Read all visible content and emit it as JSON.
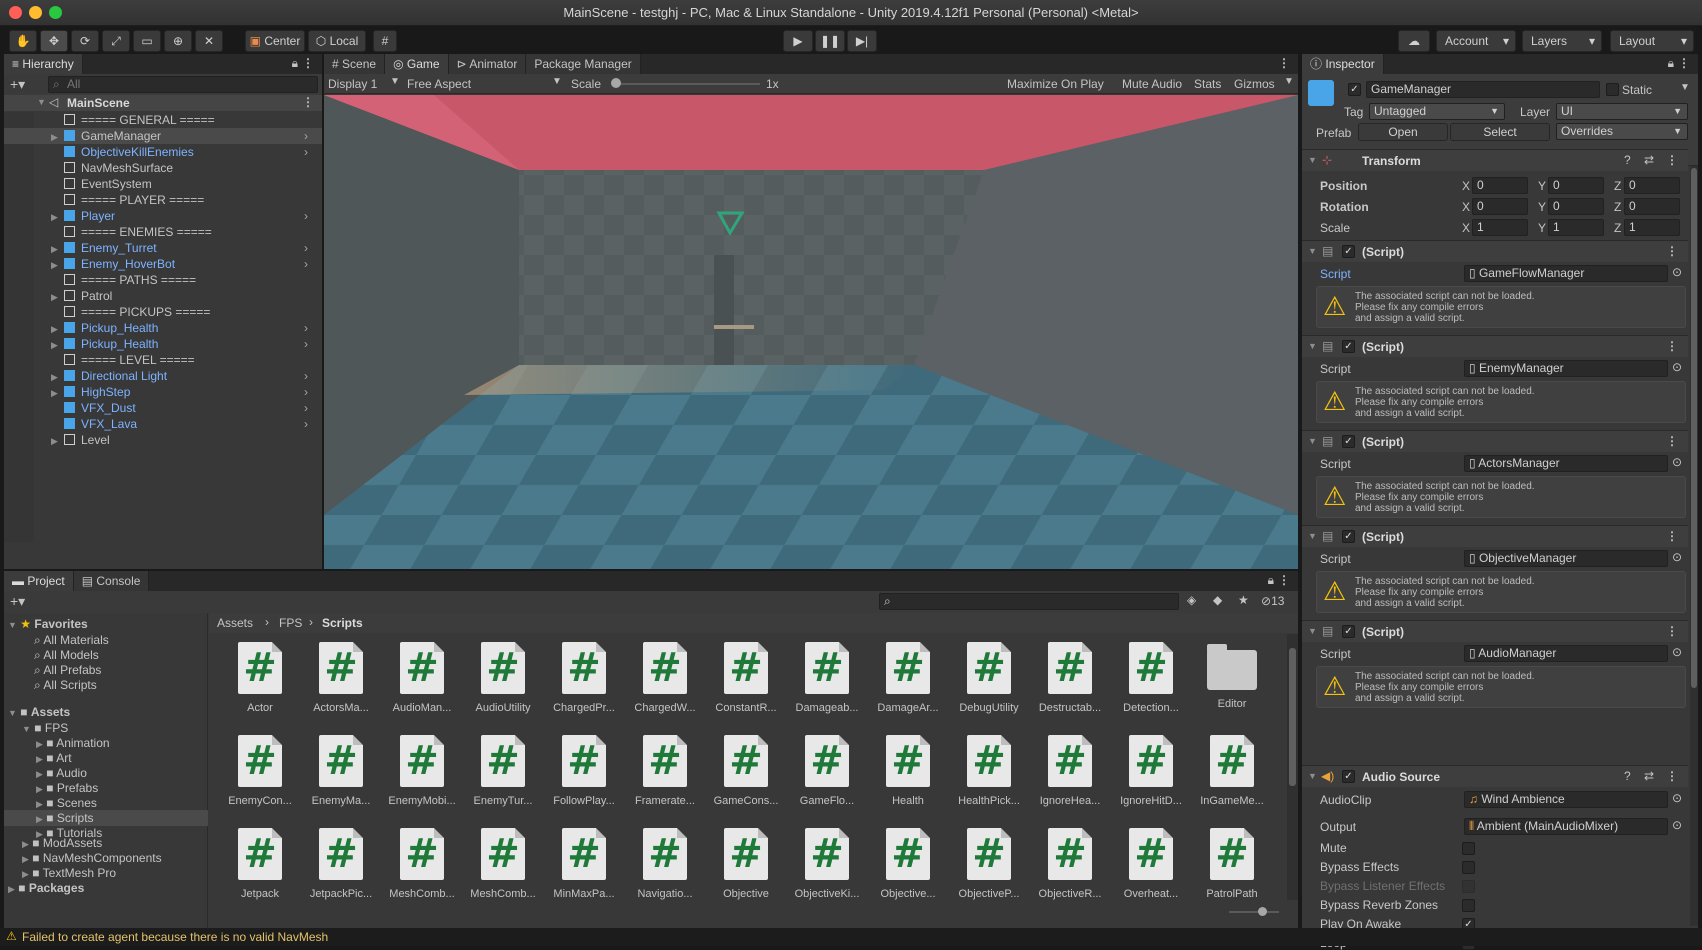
{
  "window": {
    "title": "MainScene - testghj - PC, Mac & Linux Standalone - Unity 2019.4.12f1 Personal (Personal) <Metal>"
  },
  "toolbar": {
    "pivot_label": "Center",
    "space_label": "Local",
    "account_label": "Account",
    "layers_label": "Layers",
    "layout_label": "Layout"
  },
  "hierarchy": {
    "tab_label": "Hierarchy",
    "search_placeholder": "All",
    "scene_name": "MainScene",
    "items": [
      {
        "label": "===== GENERAL =====",
        "prefab": false,
        "expandable": false,
        "chevron": false
      },
      {
        "label": "GameManager",
        "prefab": true,
        "expandable": true,
        "chevron": true,
        "selected": true,
        "plain": true
      },
      {
        "label": "ObjectiveKillEnemies",
        "prefab": true,
        "expandable": false,
        "chevron": true
      },
      {
        "label": "NavMeshSurface",
        "prefab": false,
        "expandable": false,
        "chevron": false
      },
      {
        "label": "EventSystem",
        "prefab": false,
        "expandable": false,
        "chevron": false
      },
      {
        "label": "===== PLAYER =====",
        "prefab": false,
        "expandable": false,
        "chevron": false
      },
      {
        "label": "Player",
        "prefab": true,
        "expandable": true,
        "chevron": true
      },
      {
        "label": "===== ENEMIES =====",
        "prefab": false,
        "expandable": false,
        "chevron": false
      },
      {
        "label": "Enemy_Turret",
        "prefab": true,
        "expandable": true,
        "chevron": true
      },
      {
        "label": "Enemy_HoverBot",
        "prefab": true,
        "expandable": true,
        "chevron": true
      },
      {
        "label": "===== PATHS =====",
        "prefab": false,
        "expandable": false,
        "chevron": false
      },
      {
        "label": "Patrol",
        "prefab": false,
        "expandable": true,
        "chevron": false
      },
      {
        "label": "===== PICKUPS =====",
        "prefab": false,
        "expandable": false,
        "chevron": false
      },
      {
        "label": "Pickup_Health",
        "prefab": true,
        "expandable": true,
        "chevron": true
      },
      {
        "label": "Pickup_Health",
        "prefab": true,
        "expandable": true,
        "chevron": true
      },
      {
        "label": "===== LEVEL =====",
        "prefab": false,
        "expandable": false,
        "chevron": false
      },
      {
        "label": "Directional Light",
        "prefab": true,
        "expandable": true,
        "chevron": true
      },
      {
        "label": "HighStep",
        "prefab": true,
        "expandable": true,
        "chevron": true
      },
      {
        "label": "VFX_Dust",
        "prefab": true,
        "expandable": false,
        "chevron": true
      },
      {
        "label": "VFX_Lava",
        "prefab": true,
        "expandable": false,
        "chevron": true
      },
      {
        "label": "Level",
        "prefab": false,
        "expandable": true,
        "chevron": false
      }
    ]
  },
  "game_view": {
    "tabs": [
      "Scene",
      "Game",
      "Animator",
      "Package Manager"
    ],
    "display": "Display 1",
    "aspect": "Free Aspect",
    "scale_label": "Scale",
    "scale_value": "1x",
    "buttons": [
      "Maximize On Play",
      "Mute Audio",
      "Stats",
      "Gizmos"
    ]
  },
  "project": {
    "tabs": [
      "Project",
      "Console"
    ],
    "hidden_count": "13",
    "favorites_label": "Favorites",
    "favorites": [
      "All Materials",
      "All Models",
      "All Prefabs",
      "All Scripts"
    ],
    "assets_label": "Assets",
    "fps_label": "FPS",
    "fps_children": [
      "Animation",
      "Art",
      "Audio",
      "Prefabs",
      "Scenes",
      "Scripts",
      "Tutorials"
    ],
    "asset_roots": [
      "ModAssets",
      "NavMeshComponents",
      "TextMesh Pro"
    ],
    "packages_label": "Packages",
    "breadcrumb": [
      "Assets",
      "FPS",
      "Scripts"
    ],
    "items": [
      "Actor",
      "ActorsMa...",
      "AudioMan...",
      "AudioUtility",
      "ChargedPr...",
      "ChargedW...",
      "ConstantR...",
      "Damageab...",
      "DamageAr...",
      "DebugUtility",
      "Destructab...",
      "Detection...",
      "Editor",
      "EnemyCon...",
      "EnemyMa...",
      "EnemyMobi...",
      "EnemyTur...",
      "FollowPlay...",
      "Framerate...",
      "GameCons...",
      "GameFlo...",
      "Health",
      "HealthPick...",
      "IgnoreHea...",
      "IgnoreHitD...",
      "InGameMe...",
      "Jetpack",
      "JetpackPic...",
      "MeshComb...",
      "MeshComb...",
      "MinMaxPa...",
      "Navigatio...",
      "Objective",
      "ObjectiveKi...",
      "Objective...",
      "ObjectiveP...",
      "ObjectiveR...",
      "Overheat...",
      "PatrolPath"
    ]
  },
  "inspector": {
    "tab_label": "Inspector",
    "object_name": "GameManager",
    "static_label": "Static",
    "tag_label": "Tag",
    "tag_value": "Untagged",
    "layer_label": "Layer",
    "layer_value": "UI",
    "prefab_label": "Prefab",
    "prefab_open": "Open",
    "prefab_select": "Select",
    "prefab_overrides": "Overrides",
    "transform": {
      "title": "Transform",
      "rows": [
        {
          "label": "Position",
          "x": "0",
          "y": "0",
          "z": "0"
        },
        {
          "label": "Rotation",
          "x": "0",
          "y": "0",
          "z": "0"
        },
        {
          "label": "Scale",
          "x": "1",
          "y": "1",
          "z": "1"
        }
      ]
    },
    "scripts": [
      {
        "header": "(Script)",
        "label": "Script",
        "value": "GameFlowManager"
      },
      {
        "header": "(Script)",
        "label": "Script",
        "value": "EnemyManager"
      },
      {
        "header": "(Script)",
        "label": "Script",
        "value": "ActorsManager"
      },
      {
        "header": "(Script)",
        "label": "Script",
        "value": "ObjectiveManager"
      },
      {
        "header": "(Script)",
        "label": "Script",
        "value": "AudioManager"
      }
    ],
    "warning_lines": [
      "The associated script can not be loaded.",
      "Please fix any compile errors",
      "and assign a valid script."
    ],
    "audio_source": {
      "title": "Audio Source",
      "clip_label": "AudioClip",
      "clip_value": "Wind Ambience",
      "output_label": "Output",
      "output_value": "Ambient (MainAudioMixer)",
      "flags": [
        {
          "label": "Mute",
          "checked": false,
          "disabled": false
        },
        {
          "label": "Bypass Effects",
          "checked": false,
          "disabled": false
        },
        {
          "label": "Bypass Listener Effects",
          "checked": false,
          "disabled": true
        },
        {
          "label": "Bypass Reverb Zones",
          "checked": false,
          "disabled": false
        },
        {
          "label": "Play On Awake",
          "checked": true,
          "disabled": false
        },
        {
          "label": "Loop",
          "checked": true,
          "disabled": false
        }
      ]
    }
  },
  "status_bar": {
    "message": "Failed to create agent because there is no valid NavMesh"
  },
  "colors": {
    "accent_blue": "#7eb3ff",
    "warning_yellow": "#f4c20d",
    "script_green": "#1f7a3a"
  }
}
